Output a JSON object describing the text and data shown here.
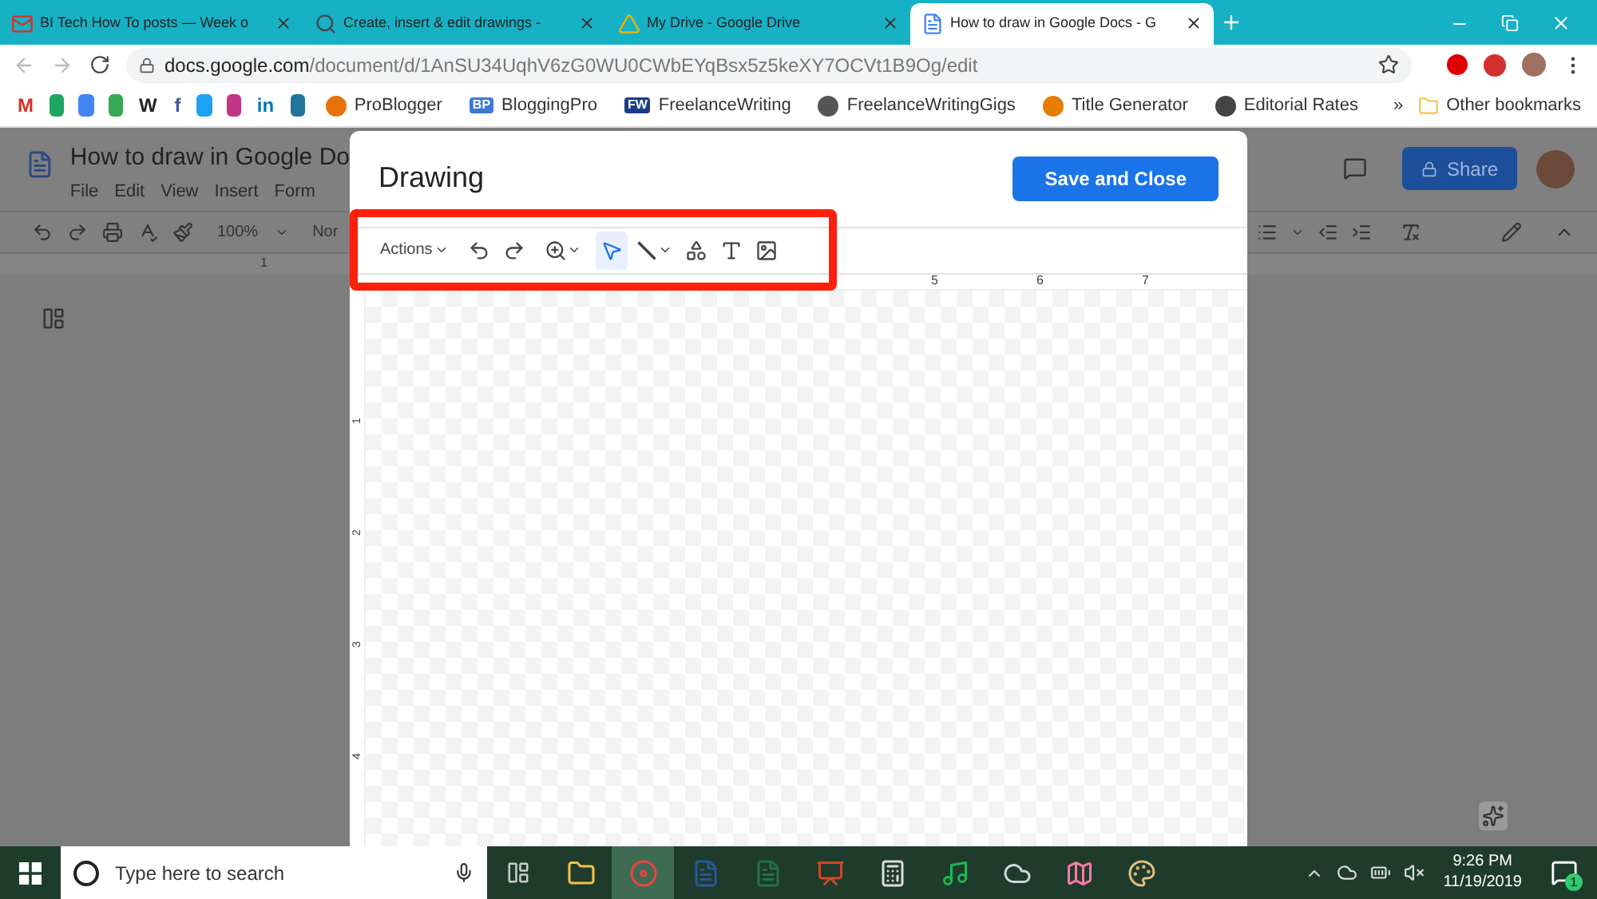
{
  "browser": {
    "tabs": [
      {
        "title": "BI Tech How To posts — Week o",
        "kind": "mail",
        "selected": false
      },
      {
        "title": "Create, insert & edit drawings -",
        "kind": "search",
        "selected": false
      },
      {
        "title": "My Drive - Google Drive",
        "kind": "drive",
        "selected": false
      },
      {
        "title": "How to draw in Google Docs - G",
        "kind": "doc",
        "selected": true
      }
    ],
    "address": "docs.google.com",
    "path": "/document/d/1AnSU34UqhV6zG0WU0CWbEYqBsx5z5keXY7OCVt1B9Og/edit",
    "bookmarks": [
      {
        "kind": "glyph",
        "glyph": "M",
        "color": "#d93025"
      },
      {
        "kind": "shape",
        "color": "#1fa463"
      },
      {
        "kind": "shape",
        "color": "#4285f4"
      },
      {
        "kind": "shape",
        "color": "#34a853"
      },
      {
        "kind": "glyph",
        "glyph": "W",
        "color": "#222222"
      },
      {
        "kind": "glyph",
        "glyph": "f",
        "color": "#3b5998"
      },
      {
        "kind": "shape",
        "color": "#1da1f2"
      },
      {
        "kind": "shape",
        "color": "#c13584"
      },
      {
        "kind": "glyph",
        "glyph": "in",
        "color": "#0077b5"
      },
      {
        "kind": "shape",
        "color": "#21759b"
      },
      {
        "kind": "link",
        "label": "ProBlogger",
        "color": "#e8710a"
      },
      {
        "kind": "link",
        "label": "BloggingPro",
        "glyph": "BP",
        "color": "#3c78d8"
      },
      {
        "kind": "link",
        "label": "FreelanceWriting",
        "glyph": "FW",
        "color": "#1a3b8c"
      },
      {
        "kind": "link",
        "label": "FreelanceWritingGigs",
        "color": "#555555"
      },
      {
        "kind": "link",
        "label": "Title Generator",
        "color": "#e67c00"
      },
      {
        "kind": "link",
        "label": "Editorial Rates",
        "color": "#444444"
      }
    ],
    "more": "»",
    "other": "Other bookmarks"
  },
  "docs": {
    "title": "How to draw in Google Do",
    "menus": [
      "File",
      "Edit",
      "View",
      "Insert",
      "Form"
    ],
    "zoom": "100%",
    "style": "Nor",
    "ruler_mark": "1",
    "share": "Share"
  },
  "drawing": {
    "title": "Drawing",
    "save": "Save and Close",
    "tools": [
      {
        "kind": "menu",
        "label": "Actions",
        "selected": false
      },
      {
        "kind": "undo",
        "selected": false
      },
      {
        "kind": "redo",
        "selected": false
      },
      {
        "kind": "zoom",
        "selected": false
      },
      {
        "kind": "select",
        "selected": true
      },
      {
        "kind": "line",
        "selected": false
      },
      {
        "kind": "shape",
        "selected": false
      },
      {
        "kind": "textbox",
        "selected": false
      },
      {
        "kind": "image",
        "selected": false
      }
    ],
    "ruler": [
      "5",
      "6",
      "7"
    ],
    "vruler": [
      "1",
      "2",
      "3",
      "4"
    ]
  },
  "taskbar": {
    "search": "Type here to search",
    "apps": [
      {
        "kind": "folder",
        "selected": false
      },
      {
        "kind": "chrome",
        "selected": true
      },
      {
        "kind": "word",
        "selected": false
      },
      {
        "kind": "excel",
        "selected": false
      },
      {
        "kind": "powerpoint",
        "selected": false
      },
      {
        "kind": "calculator",
        "selected": false
      },
      {
        "kind": "spotify",
        "selected": false
      },
      {
        "kind": "cloud-app",
        "selected": false
      },
      {
        "kind": "maps",
        "selected": false
      },
      {
        "kind": "paint",
        "selected": false
      }
    ],
    "time": "9:26 PM",
    "date": "11/19/2019",
    "notifications": "1"
  }
}
